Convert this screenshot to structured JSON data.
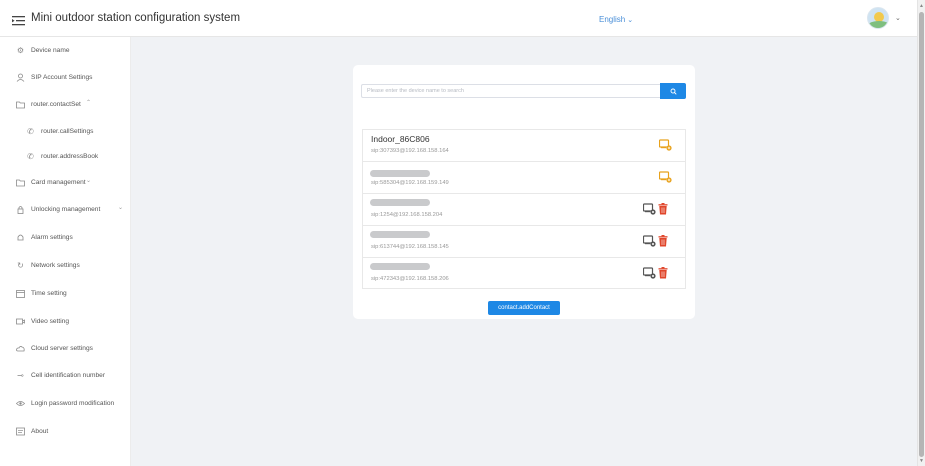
{
  "header": {
    "title": "Mini outdoor station configuration system",
    "language": "English",
    "colors": {
      "accent": "#1e88e5",
      "language_link": "#4a8fd8"
    }
  },
  "sidebar": {
    "items": [
      {
        "label": "Device name",
        "icon": "gear-icon"
      },
      {
        "label": "SIP Account Settings",
        "icon": "user-icon"
      },
      {
        "label": "router.contactSet",
        "icon": "folder-icon",
        "expanded": true
      },
      {
        "label": "router.callSettings",
        "icon": "phone-icon"
      },
      {
        "label": "router.addressBook",
        "icon": "phone-icon"
      },
      {
        "label": "Card management",
        "icon": "folder-icon",
        "expanded": false
      },
      {
        "label": "Unlocking management",
        "icon": "lock-icon",
        "expanded": false
      },
      {
        "label": "Alarm settings",
        "icon": "bell-icon"
      },
      {
        "label": "Network settings",
        "icon": "refresh-icon"
      },
      {
        "label": "Time setting",
        "icon": "calendar-icon"
      },
      {
        "label": "Video setting",
        "icon": "video-icon"
      },
      {
        "label": "Cloud server settings",
        "icon": "cloud-icon"
      },
      {
        "label": "Cell identification number",
        "icon": "tag-icon"
      },
      {
        "label": "Login password modification",
        "icon": "eye-icon"
      },
      {
        "label": "About",
        "icon": "info-icon"
      }
    ]
  },
  "search": {
    "placeholder": "Please enter the device name to search",
    "button_icon": "search-icon"
  },
  "contacts": [
    {
      "name": "Indoor_86C806",
      "sip": "sip:307393@192.168.158.164",
      "name_obscured": false,
      "actions": [
        "add-device-icon"
      ]
    },
    {
      "name": "",
      "sip": "sip:585304@192.168.159.149",
      "name_obscured": true,
      "actions": [
        "add-device-icon"
      ]
    },
    {
      "name": "",
      "sip": "sip:1254@192.168.158.204",
      "name_obscured": true,
      "actions": [
        "device-settings-icon",
        "trash-icon"
      ]
    },
    {
      "name": "",
      "sip": "sip:613744@192.168.158.145",
      "name_obscured": true,
      "actions": [
        "device-settings-icon",
        "trash-icon"
      ]
    },
    {
      "name": "",
      "sip": "sip:472343@192.168.158.206",
      "name_obscured": true,
      "actions": [
        "device-settings-icon",
        "trash-icon"
      ]
    }
  ],
  "add_contact_label": "contact.addContact"
}
